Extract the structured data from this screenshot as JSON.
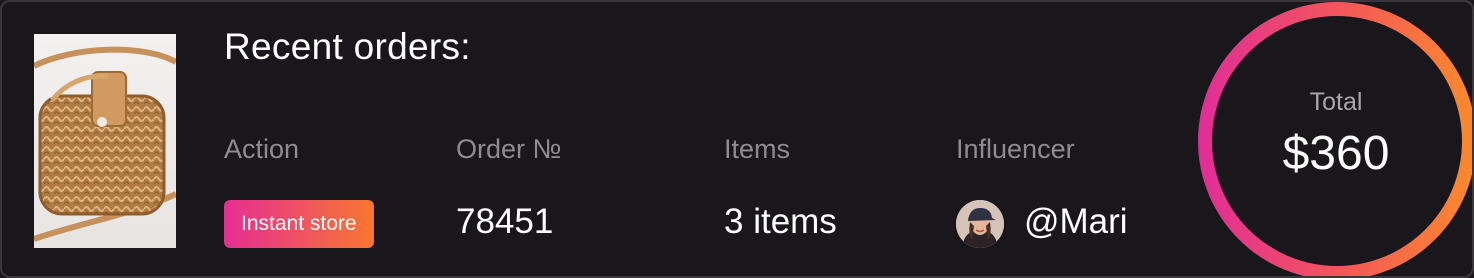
{
  "card": {
    "title": "Recent orders:",
    "product_image": "wicker-bag-photo"
  },
  "columns": {
    "action": {
      "label": "Action",
      "value": "Instant store"
    },
    "order": {
      "label": "Order №",
      "value": "78451"
    },
    "items": {
      "label": "Items",
      "value": "3 items"
    },
    "influencer": {
      "label": "Influencer",
      "value": "@Mari",
      "avatar": "influencer-avatar"
    }
  },
  "total": {
    "label": "Total",
    "value": "$360"
  },
  "colors": {
    "background": "#19171c",
    "border": "#3a383d",
    "label_gray": "#8e8b92",
    "gradient_start": "#e62e93",
    "gradient_end": "#f8772f"
  }
}
